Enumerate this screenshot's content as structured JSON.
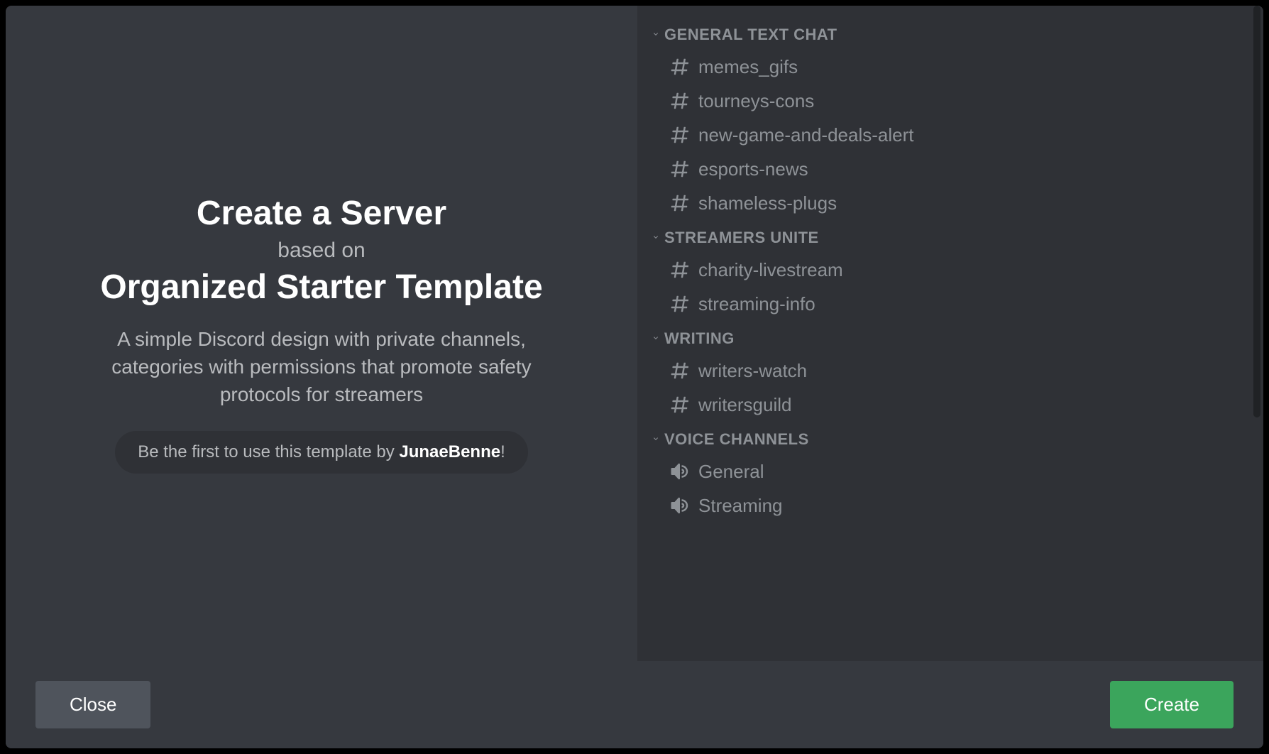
{
  "header": {
    "title": "Create a Server",
    "subtitle": "based on",
    "template_name": "Organized Starter Template"
  },
  "description": "A simple Discord design with private channels, categories with permissions that promote safety protocols for streamers",
  "badge": {
    "prefix": "Be the first to use this template by ",
    "author": "JunaeBenne",
    "suffix": "!"
  },
  "categories": [
    {
      "name": "GENERAL TEXT CHAT",
      "channels": [
        {
          "type": "text",
          "name": "memes_gifs"
        },
        {
          "type": "text",
          "name": "tourneys-cons"
        },
        {
          "type": "text",
          "name": "new-game-and-deals-alert"
        },
        {
          "type": "text",
          "name": "esports-news"
        },
        {
          "type": "text",
          "name": "shameless-plugs"
        }
      ]
    },
    {
      "name": "STREAMERS UNITE",
      "channels": [
        {
          "type": "text",
          "name": "charity-livestream"
        },
        {
          "type": "text",
          "name": "streaming-info"
        }
      ]
    },
    {
      "name": "WRITING",
      "channels": [
        {
          "type": "text",
          "name": "writers-watch"
        },
        {
          "type": "text",
          "name": "writersguild"
        }
      ]
    },
    {
      "name": "VOICE CHANNELS",
      "channels": [
        {
          "type": "voice",
          "name": "General"
        },
        {
          "type": "voice",
          "name": "Streaming"
        }
      ]
    }
  ],
  "footer": {
    "close_label": "Close",
    "create_label": "Create"
  }
}
